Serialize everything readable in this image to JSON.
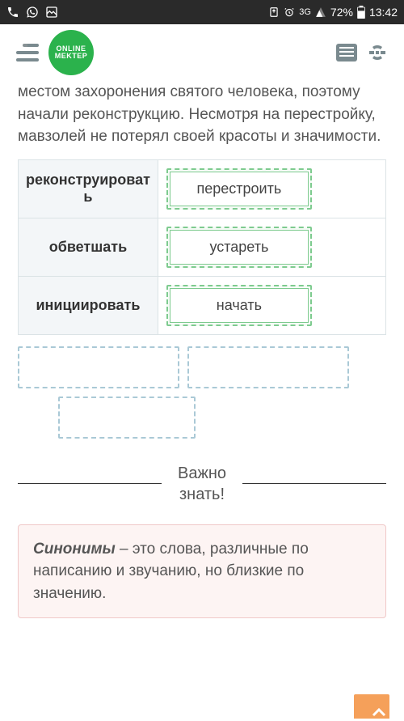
{
  "status_bar": {
    "time": "13:42",
    "battery": "72%",
    "network": "3G"
  },
  "header": {
    "logo_line1": "ONLINE",
    "logo_line2": "MEKTEP"
  },
  "paragraph": "местом захоронения святого человека, поэтому начали реконструкцию. Несмотря на перестройку, мавзолей не потерял своей красоты и значимости.",
  "match_rows": [
    {
      "term": "реконструировать",
      "answer": "перестроить"
    },
    {
      "term": "обветшать",
      "answer": "устареть"
    },
    {
      "term": "инициировать",
      "answer": "начать"
    }
  ],
  "divider": {
    "line1": "Важно",
    "line2": "знать!"
  },
  "info_box": {
    "bold": "Синонимы",
    "rest": " – это слова, различные по написанию и звучанию, но близкие по значению."
  }
}
